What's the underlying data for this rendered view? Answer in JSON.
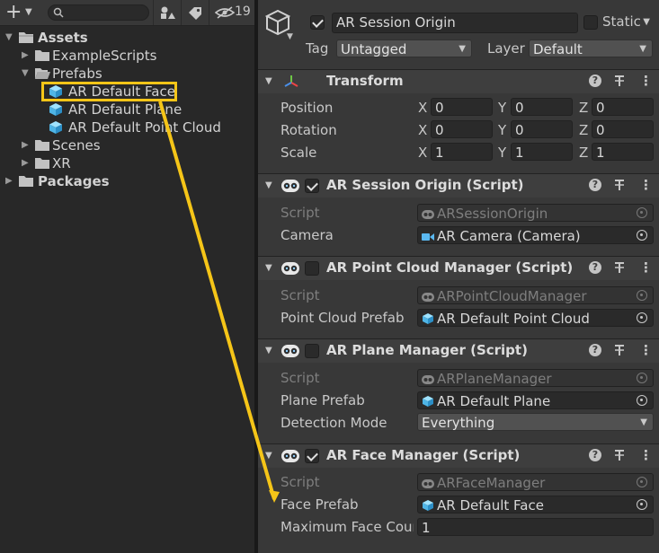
{
  "project_panel": {
    "toolbar": {
      "add_symbol": "+",
      "hidden_count": "19"
    },
    "tree": [
      {
        "label": "Assets",
        "bold": true
      },
      {
        "label": "ExampleScripts"
      },
      {
        "label": "Prefabs"
      },
      {
        "label": "AR Default Face"
      },
      {
        "label": "AR Default Plane"
      },
      {
        "label": "AR Default Point Cloud"
      },
      {
        "label": "Scenes"
      },
      {
        "label": "XR"
      },
      {
        "label": "Packages",
        "bold": true
      }
    ]
  },
  "inspector": {
    "object_name": "AR Session Origin",
    "static_label": "Static",
    "tag_label": "Tag",
    "tag_value": "Untagged",
    "layer_label": "Layer",
    "layer_value": "Default",
    "transform": {
      "title": "Transform",
      "rows": [
        {
          "label": "Position",
          "x": "0",
          "y": "0",
          "z": "0"
        },
        {
          "label": "Rotation",
          "x": "0",
          "y": "0",
          "z": "0"
        },
        {
          "label": "Scale",
          "x": "1",
          "y": "1",
          "z": "1"
        }
      ],
      "axis": {
        "x": "X",
        "y": "Y",
        "z": "Z"
      }
    },
    "components": [
      {
        "title": "AR Session Origin (Script)",
        "enabled": true,
        "script_label": "Script",
        "script_value": "ARSessionOrigin",
        "field_label": "Camera",
        "field_value": "AR Camera (Camera)"
      },
      {
        "title": "AR Point Cloud Manager (Script)",
        "enabled": false,
        "script_label": "Script",
        "script_value": "ARPointCloudManager",
        "field_label": "Point Cloud Prefab",
        "field_value": "AR Default Point Cloud"
      },
      {
        "title": "AR Plane Manager (Script)",
        "enabled": false,
        "script_label": "Script",
        "script_value": "ARPlaneManager",
        "field_label": "Plane Prefab",
        "field_value": "AR Default Plane",
        "extra_label": "Detection Mode",
        "extra_value": "Everything"
      },
      {
        "title": "AR Face Manager (Script)",
        "enabled": true,
        "script_label": "Script",
        "script_value": "ARFaceManager",
        "field_label": "Face Prefab",
        "field_value": "AR Default Face",
        "extra_label": "Maximum Face Cour",
        "extra_value": "1"
      }
    ]
  },
  "annotation": {
    "highlight_color": "#f5c518",
    "arrow_color": "#f5c518"
  },
  "icons": [
    "plus-icon",
    "search-icon",
    "scene-filter-icon",
    "tag-icon",
    "eye-hidden-icon",
    "folder-icon",
    "prefab-cube-icon",
    "gameobject-cube-icon",
    "transform-axes-icon",
    "script-icon",
    "help-icon",
    "preset-icon",
    "kebab-menu-icon",
    "object-picker-icon",
    "camera-icon"
  ]
}
